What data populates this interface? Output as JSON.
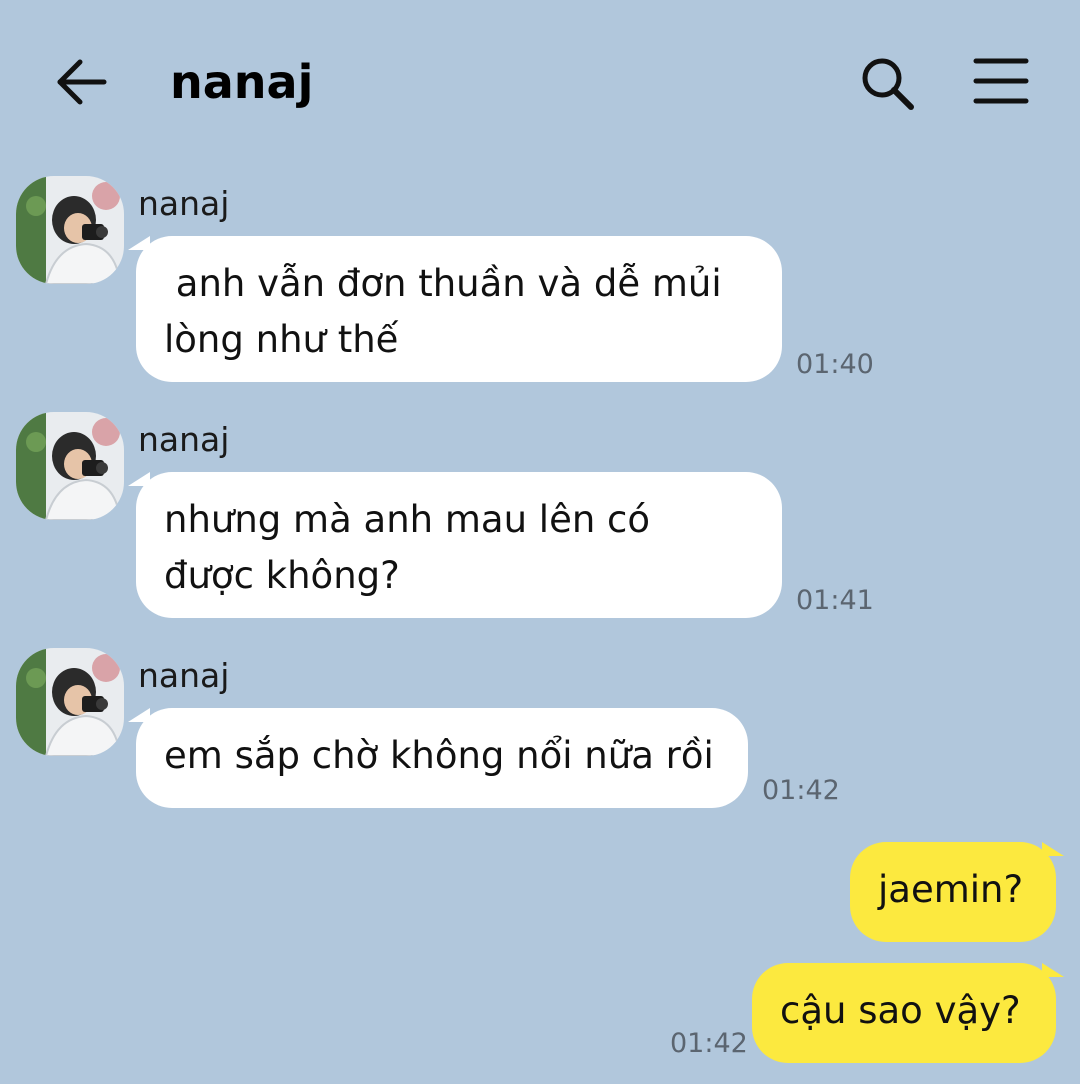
{
  "header": {
    "title": "nanaj",
    "back_icon": "arrow-left-icon",
    "search_icon": "search-icon",
    "menu_icon": "hamburger-menu-icon"
  },
  "colors": {
    "background": "#b1c7dc",
    "incoming_bubble": "#ffffff",
    "outgoing_bubble": "#fce93f",
    "timestamp": "#5b6570"
  },
  "messages": [
    {
      "sender": "nanaj",
      "text": " anh vẫn đơn thuần và dễ mủi\nlòng như thế",
      "time": "01:40"
    },
    {
      "sender": "nanaj",
      "text": "nhưng mà anh mau lên có\nđược không?",
      "time": "01:41"
    },
    {
      "sender": "nanaj",
      "text": "em sắp chờ không nổi nữa rồi",
      "time": "01:42"
    }
  ],
  "my_messages": [
    {
      "text": "jaemin?"
    },
    {
      "text": "cậu sao vậy?",
      "time": "01:42"
    }
  ]
}
